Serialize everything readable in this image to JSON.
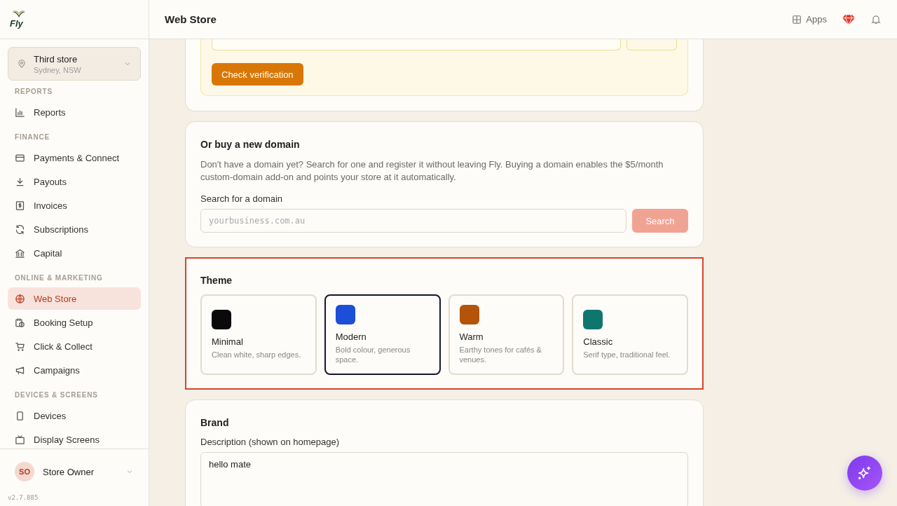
{
  "brand": {
    "name": "Fly"
  },
  "store": {
    "name": "Third store",
    "location": "Sydney, NSW"
  },
  "nav_sections": [
    {
      "label": "REPORTS",
      "items": [
        {
          "label": "Reports",
          "kind": "chart",
          "selected": false
        }
      ]
    },
    {
      "label": "FINANCE",
      "items": [
        {
          "label": "Payments & Connect",
          "kind": "card",
          "selected": false
        },
        {
          "label": "Payouts",
          "kind": "download",
          "selected": false
        },
        {
          "label": "Invoices",
          "kind": "invoice",
          "selected": false
        },
        {
          "label": "Subscriptions",
          "kind": "refresh",
          "selected": false
        },
        {
          "label": "Capital",
          "kind": "bank",
          "selected": false
        }
      ]
    },
    {
      "label": "ONLINE & MARKETING",
      "items": [
        {
          "label": "Web Store",
          "kind": "globe",
          "selected": true
        },
        {
          "label": "Booking Setup",
          "kind": "calendar",
          "selected": false
        },
        {
          "label": "Click & Collect",
          "kind": "cart",
          "selected": false
        },
        {
          "label": "Campaigns",
          "kind": "megaphone",
          "selected": false
        }
      ]
    },
    {
      "label": "DEVICES & SCREENS",
      "items": [
        {
          "label": "Devices",
          "kind": "tablet",
          "selected": false
        },
        {
          "label": "Display Screens",
          "kind": "tv",
          "selected": false
        }
      ]
    }
  ],
  "user": {
    "initials": "SO",
    "name": "Store Owner"
  },
  "version": "v2.7.885",
  "header": {
    "title": "Web Store",
    "apps": "Apps"
  },
  "verification": {
    "button": "Check verification"
  },
  "domain": {
    "title": "Or buy a new domain",
    "description": "Don't have a domain yet? Search for one and register it without leaving Fly. Buying a domain enables the $5/month custom-domain add-on and points your store at it automatically.",
    "label": "Search for a domain",
    "placeholder": "yourbusiness.com.au",
    "button": "Search"
  },
  "theme": {
    "title": "Theme",
    "highlighted": true,
    "options": [
      {
        "name": "Minimal",
        "description": "Clean white, sharp edges.",
        "color": "#0a0a0a",
        "selected": false
      },
      {
        "name": "Modern",
        "description": "Bold colour, generous space.",
        "color": "#1d4ed8",
        "selected": true
      },
      {
        "name": "Warm",
        "description": "Earthy tones for cafés & venues.",
        "color": "#b4530a",
        "selected": false
      },
      {
        "name": "Classic",
        "description": "Serif type, traditional feel.",
        "color": "#0f766e",
        "selected": false
      }
    ]
  },
  "brand_section": {
    "title": "Brand",
    "label": "Description (shown on homepage)",
    "value": "hello mate"
  }
}
